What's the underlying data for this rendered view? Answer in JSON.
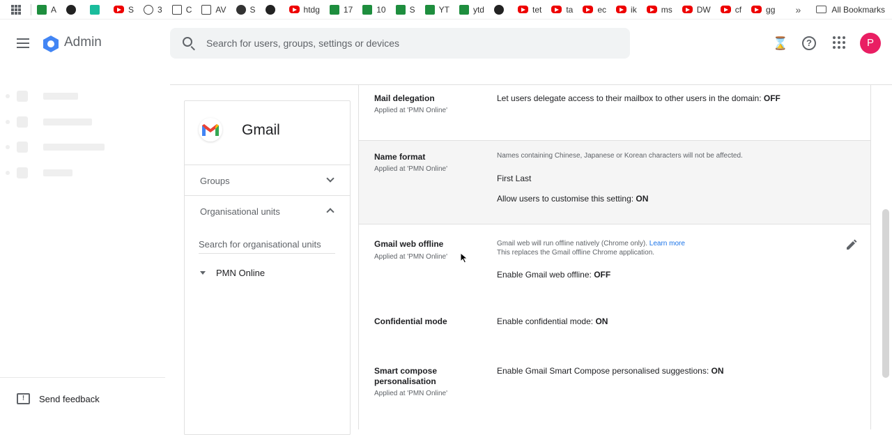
{
  "bookmarks": [
    {
      "label": "A",
      "icon": "sheets-icon"
    },
    {
      "label": "",
      "icon": "puzzle-icon"
    },
    {
      "label": "",
      "icon": "teal-app-icon"
    },
    {
      "label": "S",
      "icon": "youtube-icon"
    },
    {
      "label": "3",
      "icon": "openai-icon"
    },
    {
      "label": "C",
      "icon": "folder-icon"
    },
    {
      "label": "AV",
      "icon": "trend-icon"
    },
    {
      "label": "S",
      "icon": "globe-icon"
    },
    {
      "label": "",
      "icon": "github-icon"
    },
    {
      "label": "htdg",
      "icon": "youtube-icon"
    },
    {
      "label": "17",
      "icon": "sheets-icon"
    },
    {
      "label": "10",
      "icon": "sheets-icon"
    },
    {
      "label": "S",
      "icon": "sheets-icon"
    },
    {
      "label": "YT",
      "icon": "sheets-icon"
    },
    {
      "label": "ytd",
      "icon": "sheets-icon"
    },
    {
      "label": "",
      "icon": "pin-icon"
    },
    {
      "label": "tet",
      "icon": "youtube-icon"
    },
    {
      "label": "ta",
      "icon": "youtube-icon"
    },
    {
      "label": "ec",
      "icon": "youtube-icon"
    },
    {
      "label": "ik",
      "icon": "youtube-icon"
    },
    {
      "label": "ms",
      "icon": "youtube-icon"
    },
    {
      "label": "DW",
      "icon": "youtube-icon"
    },
    {
      "label": "cf",
      "icon": "youtube-icon"
    },
    {
      "label": "gg",
      "icon": "youtube-icon"
    }
  ],
  "bookmarks_more": "»",
  "all_bookmarks": "All Bookmarks",
  "header": {
    "brand": "Admin",
    "search_placeholder": "Search for users, groups, settings or devices",
    "avatar_letter": "P"
  },
  "sidebar": {
    "send_feedback": "Send feedback"
  },
  "app_card": {
    "title": "Gmail",
    "groups_label": "Groups",
    "org_units_label": "Organisational units",
    "ou_search_placeholder": "Search for organisational units",
    "ou_root": "PMN Online"
  },
  "settings": [
    {
      "title": "Mail delegation",
      "applied": "Applied at 'PMN Online'",
      "value_text": "Let users delegate access to their mailbox to other users in the domain: ",
      "value_state": "OFF"
    },
    {
      "title": "Name format",
      "applied": "Applied at 'PMN Online'",
      "note": "Names containing Chinese, Japanese or Korean characters will not be affected.",
      "format": "First Last",
      "value_text": "Allow users to customise this setting: ",
      "value_state": "ON"
    },
    {
      "title": "Gmail web offline",
      "applied": "Applied at 'PMN Online'",
      "note_line1": "Gmail web will run offline natively (Chrome only). ",
      "learn_more": "Learn more",
      "note_line2": "This replaces the Gmail offline Chrome application.",
      "value_text": "Enable Gmail web offline: ",
      "value_state": "OFF"
    },
    {
      "title": "Confidential mode",
      "value_text": "Enable confidential mode: ",
      "value_state": "ON"
    },
    {
      "title_line1": "Smart compose",
      "title_line2": "personalisation",
      "applied": "Applied at 'PMN Online'",
      "value_text": "Enable Gmail Smart Compose personalised suggestions: ",
      "value_state": "ON"
    }
  ],
  "colors": {
    "avatar": "#e91e63",
    "link": "#1a73e8",
    "youtube": "#ee0000",
    "sheets": "#1e8e3e"
  }
}
